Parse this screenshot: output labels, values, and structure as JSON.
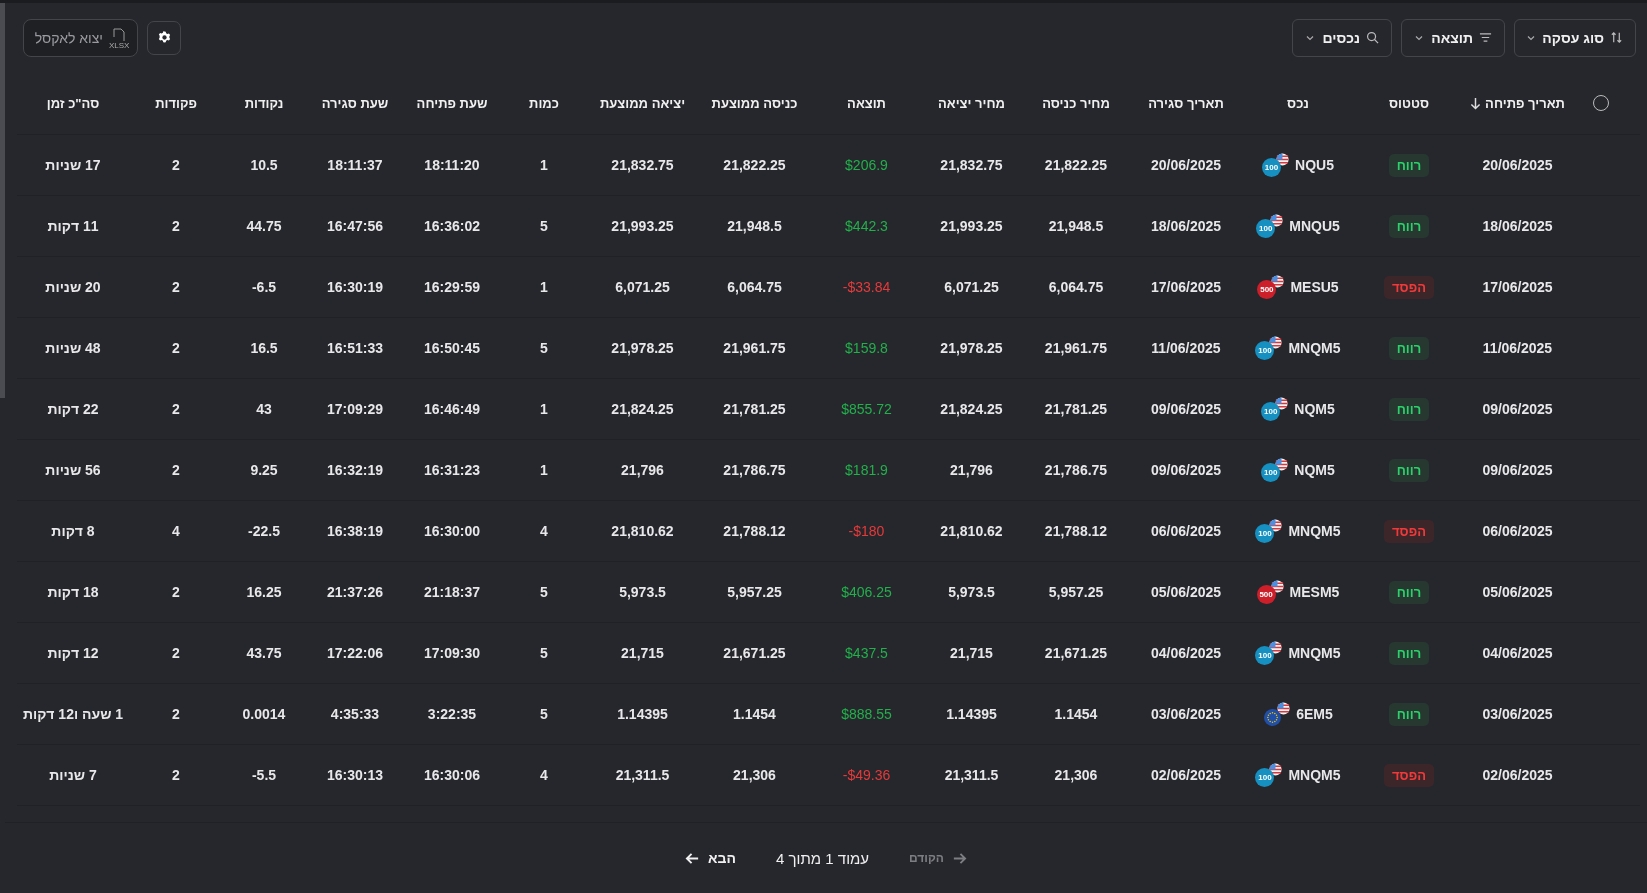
{
  "toolbar": {
    "export_button": {
      "label": "יצוא לאקסל",
      "icon_text": "XLSX"
    },
    "filters": [
      {
        "label": "סוג עסקה",
        "kind": "sort"
      },
      {
        "label": "תוצאה",
        "kind": "filter"
      },
      {
        "label": "נכסים",
        "kind": "search"
      }
    ]
  },
  "table": {
    "select_all": {
      "checked": false
    },
    "columns": [
      {
        "label": "תאריך פתיחה",
        "sorted": true
      },
      {
        "label": "סטטוס",
        "sorted": false
      },
      {
        "label": "נכס",
        "sorted": false
      },
      {
        "label": "תאריך סגירה",
        "sorted": false
      },
      {
        "label": "מחיר כניסה",
        "sorted": false
      },
      {
        "label": "מחיר יציאה",
        "sorted": false
      },
      {
        "label": "תוצאה",
        "sorted": false
      },
      {
        "label": "כניסה ממוצעת",
        "sorted": false
      },
      {
        "label": "יציאה ממוצעת",
        "sorted": false
      },
      {
        "label": "כמות",
        "sorted": false
      },
      {
        "label": "שעת פתיחה",
        "sorted": false
      },
      {
        "label": "שעת סגירה",
        "sorted": false
      },
      {
        "label": "נקודות",
        "sorted": false
      },
      {
        "label": "פקודות",
        "sorted": false
      },
      {
        "label": "סה\"כ זמן",
        "sorted": false
      }
    ],
    "rows": [
      {
        "values": [
          "17 שניות",
          "2",
          "10.5",
          "18:11:37",
          "18:11:20",
          "1",
          "21,832.75",
          "21,822.25",
          "$206.9",
          "21,832.75",
          "21,822.25",
          "20/06/2025"
        ],
        "asset": {
          "symbol": "NQU5",
          "kind": "nasdaq",
          "badge": "100"
        },
        "status": {
          "label": "רווח",
          "kind": "profit"
        },
        "open_date": "20/06/2025"
      },
      {
        "values": [
          "11 דקות",
          "2",
          "44.75",
          "16:47:56",
          "16:36:02",
          "5",
          "21,993.25",
          "21,948.5",
          "$442.3",
          "21,993.25",
          "21,948.5",
          "18/06/2025"
        ],
        "asset": {
          "symbol": "MNQU5",
          "kind": "nasdaq",
          "badge": "100"
        },
        "status": {
          "label": "רווח",
          "kind": "profit"
        },
        "open_date": "18/06/2025"
      },
      {
        "values": [
          "20 שניות",
          "2",
          "-6.5",
          "16:30:19",
          "16:29:59",
          "1",
          "6,071.25",
          "6,064.75",
          "-$33.84",
          "6,071.25",
          "6,064.75",
          "17/06/2025"
        ],
        "asset": {
          "symbol": "MESU5",
          "kind": "sp",
          "badge": "500"
        },
        "status": {
          "label": "הפסד",
          "kind": "loss"
        },
        "open_date": "17/06/2025"
      },
      {
        "values": [
          "48 שניות",
          "2",
          "16.5",
          "16:51:33",
          "16:50:45",
          "5",
          "21,978.25",
          "21,961.75",
          "$159.8",
          "21,978.25",
          "21,961.75",
          "11/06/2025"
        ],
        "asset": {
          "symbol": "MNQM5",
          "kind": "nasdaq",
          "badge": "100"
        },
        "status": {
          "label": "רווח",
          "kind": "profit"
        },
        "open_date": "11/06/2025"
      },
      {
        "values": [
          "22 דקות",
          "2",
          "43",
          "17:09:29",
          "16:46:49",
          "1",
          "21,824.25",
          "21,781.25",
          "$855.72",
          "21,824.25",
          "21,781.25",
          "09/06/2025"
        ],
        "asset": {
          "symbol": "NQM5",
          "kind": "nasdaq",
          "badge": "100"
        },
        "status": {
          "label": "רווח",
          "kind": "profit"
        },
        "open_date": "09/06/2025"
      },
      {
        "values": [
          "56 שניות",
          "2",
          "9.25",
          "16:32:19",
          "16:31:23",
          "1",
          "21,796",
          "21,786.75",
          "$181.9",
          "21,796",
          "21,786.75",
          "09/06/2025"
        ],
        "asset": {
          "symbol": "NQM5",
          "kind": "nasdaq",
          "badge": "100"
        },
        "status": {
          "label": "רווח",
          "kind": "profit"
        },
        "open_date": "09/06/2025"
      },
      {
        "values": [
          "8 דקות",
          "4",
          "-22.5",
          "16:38:19",
          "16:30:00",
          "4",
          "21,810.62",
          "21,788.12",
          "-$180",
          "21,810.62",
          "21,788.12",
          "06/06/2025"
        ],
        "asset": {
          "symbol": "MNQM5",
          "kind": "nasdaq",
          "badge": "100"
        },
        "status": {
          "label": "הפסד",
          "kind": "loss"
        },
        "open_date": "06/06/2025"
      },
      {
        "values": [
          "18 דקות",
          "2",
          "16.25",
          "21:37:26",
          "21:18:37",
          "5",
          "5,973.5",
          "5,957.25",
          "$406.25",
          "5,973.5",
          "5,957.25",
          "05/06/2025"
        ],
        "asset": {
          "symbol": "MESM5",
          "kind": "sp",
          "badge": "500"
        },
        "status": {
          "label": "רווח",
          "kind": "profit"
        },
        "open_date": "05/06/2025"
      },
      {
        "values": [
          "12 דקות",
          "2",
          "43.75",
          "17:22:06",
          "17:09:30",
          "5",
          "21,715",
          "21,671.25",
          "$437.5",
          "21,715",
          "21,671.25",
          "04/06/2025"
        ],
        "asset": {
          "symbol": "MNQM5",
          "kind": "nasdaq",
          "badge": "100"
        },
        "status": {
          "label": "רווח",
          "kind": "profit"
        },
        "open_date": "04/06/2025"
      },
      {
        "values": [
          "1 שעה ו12 דקות",
          "2",
          "0.0014",
          "4:35:33",
          "3:22:35",
          "5",
          "1.14395",
          "1.1454",
          "$888.55",
          "1.14395",
          "1.1454",
          "03/06/2025"
        ],
        "asset": {
          "symbol": "6EM5",
          "kind": "euro"
        },
        "status": {
          "label": "רווח",
          "kind": "profit"
        },
        "open_date": "03/06/2025"
      },
      {
        "values": [
          "7 שניות",
          "2",
          "-5.5",
          "16:30:13",
          "16:30:06",
          "4",
          "21,311.5",
          "21,306",
          "-$49.36",
          "21,311.5",
          "21,306",
          "02/06/2025"
        ],
        "asset": {
          "symbol": "MNQM5",
          "kind": "nasdaq",
          "badge": "100"
        },
        "status": {
          "label": "הפסד",
          "kind": "loss"
        },
        "open_date": "02/06/2025"
      }
    ]
  },
  "pagination": {
    "next": {
      "label": "הבא",
      "disabled": false
    },
    "page_info": "עמוד 1 מתוך 4",
    "previous": {
      "label": "הקודם",
      "disabled": true
    }
  }
}
